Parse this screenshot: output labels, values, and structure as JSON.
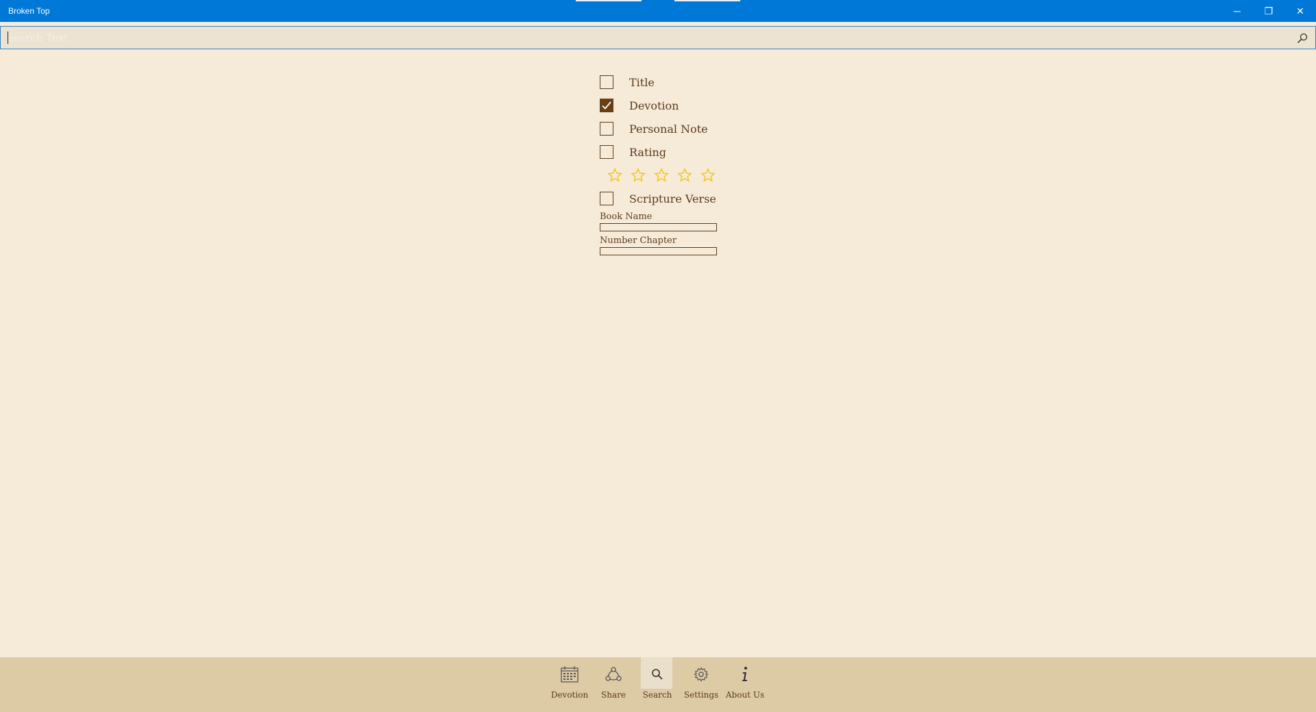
{
  "window": {
    "title": "Broken Top",
    "minimize_glyph": "─",
    "restore_glyph": "❐",
    "close_glyph": "✕"
  },
  "search": {
    "placeholder": "Search Text",
    "value": ""
  },
  "filters": [
    {
      "label": "Title",
      "checked": false
    },
    {
      "label": "Devotion",
      "checked": true
    },
    {
      "label": "Personal Note",
      "checked": false
    },
    {
      "label": "Rating",
      "checked": false
    },
    {
      "label": "Scripture Verse",
      "checked": false
    }
  ],
  "rating": {
    "value": 0,
    "max": 5,
    "star_color": "#f5c518"
  },
  "fields": {
    "book_name_label": "Book Name",
    "book_name_value": "",
    "chapter_label": "Number Chapter",
    "chapter_value": ""
  },
  "nav": {
    "items": [
      {
        "label": "Devotion",
        "icon": "calendar-icon"
      },
      {
        "label": "Share",
        "icon": "share-icon"
      },
      {
        "label": "Search",
        "icon": "search-icon",
        "selected": true
      },
      {
        "label": "Settings",
        "icon": "gear-icon"
      },
      {
        "label": "About Us",
        "icon": "info-icon"
      }
    ]
  },
  "colors": {
    "accent": "#0078d7",
    "background": "#f6ebd9",
    "text": "#5b3a1a",
    "bottom_bar": "#ddcba6"
  }
}
